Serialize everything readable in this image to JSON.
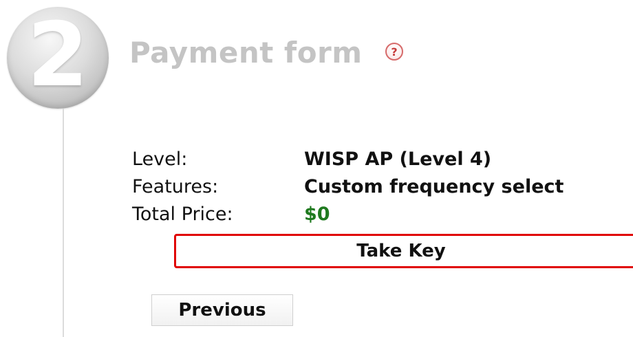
{
  "step": {
    "number": "2",
    "title": "Payment form",
    "help_icon": "question-circle-icon",
    "help_symbol": "?"
  },
  "details": {
    "level_label": "Level:",
    "level_value": "WISP AP (Level 4)",
    "features_label": "Features:",
    "features_value": "Custom frequency select",
    "total_price_label": "Total Price:",
    "total_price_value": "$0"
  },
  "actions": {
    "take_key_label": "Take Key",
    "previous_label": "Previous"
  },
  "colors": {
    "title": "#c4c4c4",
    "price": "#1f7a1f",
    "highlight_border": "#e00000",
    "help_icon": "#c63a3a"
  }
}
